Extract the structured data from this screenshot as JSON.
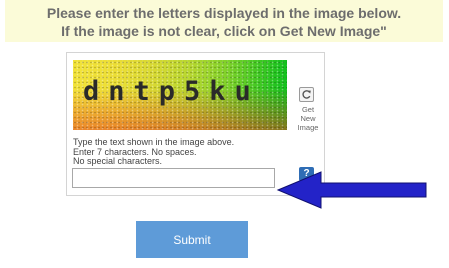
{
  "banner": {
    "line1": "Please enter the letters displayed in the image below.",
    "line2": "If the image is not clear, click on Get New Image\""
  },
  "captcha": {
    "image_text": "dntp5ku",
    "refresh_label_lines": [
      "Get",
      "New",
      "Image"
    ],
    "instructions": [
      "Type the text shown in the image above.",
      "Enter 7 characters. No spaces.",
      "No special characters."
    ],
    "input_value": "",
    "help_label": "?"
  },
  "submit_label": "Submit",
  "colors": {
    "banner_bg": "#fbfbd8",
    "submit_bg": "#5e9bd8",
    "arrow": "#2323c8",
    "help_bg": "#2f6db5"
  },
  "icons": {
    "refresh": "refresh-icon",
    "help": "help-icon",
    "arrow": "left-arrow-pointer"
  }
}
